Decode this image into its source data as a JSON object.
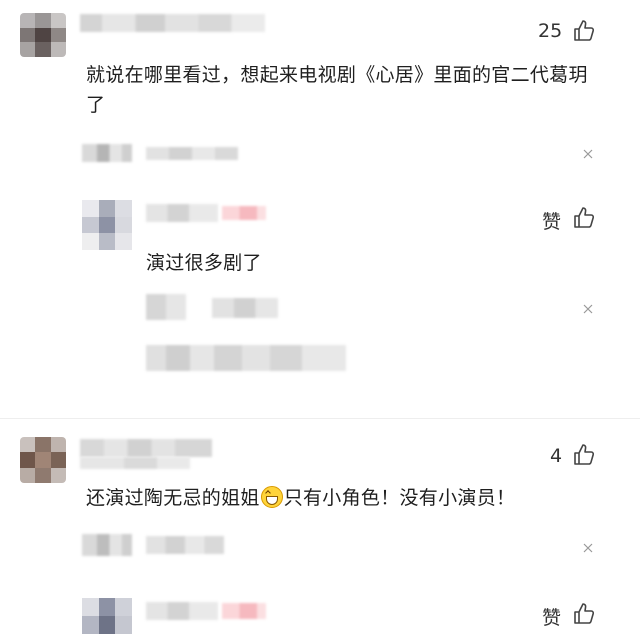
{
  "comments": [
    {
      "text": "就说在哪里看过，想起来电视剧《心居》里面的官二代葛玥了",
      "likes": "25",
      "reply": {
        "text": "演过很多剧了",
        "likes": "赞"
      }
    },
    {
      "text_before_emoji": "还演过陶无忌的姐姐",
      "emoji": "grinning-face-emoji",
      "text_after_emoji": "只有小角色！没有小演员！",
      "likes": "4",
      "reply": {
        "likes": "赞"
      }
    }
  ],
  "icons": {
    "like": "thumbs-up-icon",
    "close": "close-icon"
  },
  "colors": {
    "text": "#1f1f1f",
    "blurred_gray": "#d6d6d6",
    "blurred_pink": "#f6b9bf",
    "icon": "#444444"
  }
}
